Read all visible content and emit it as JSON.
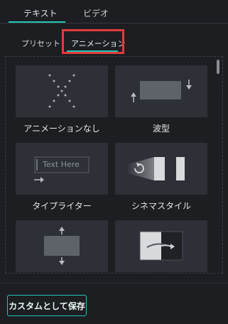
{
  "tabs": {
    "text_label": "テキスト",
    "video_label": "ビデオ"
  },
  "subtabs": {
    "preset_label": "プリセット",
    "animation_label": "アニメーション"
  },
  "cards": [
    {
      "label": "アニメーションなし",
      "icon": "x-dots-icon"
    },
    {
      "label": "波型",
      "icon": "wave-arrows-icon"
    },
    {
      "label": "タイプライター",
      "icon": "typewriter-icon",
      "placeholder_text": "Text Here"
    },
    {
      "label": "シネマスタイル",
      "icon": "cinema-icon"
    },
    {
      "label": "",
      "icon": "vertical-expand-icon"
    },
    {
      "label": "",
      "icon": "swipe-arrow-icon"
    }
  ],
  "footer": {
    "save_label": "カスタムとして保存"
  },
  "colors": {
    "accent": "#22c6b7",
    "highlight": "#e23b3b",
    "background": "#1c1e22",
    "card": "#2d3036"
  }
}
